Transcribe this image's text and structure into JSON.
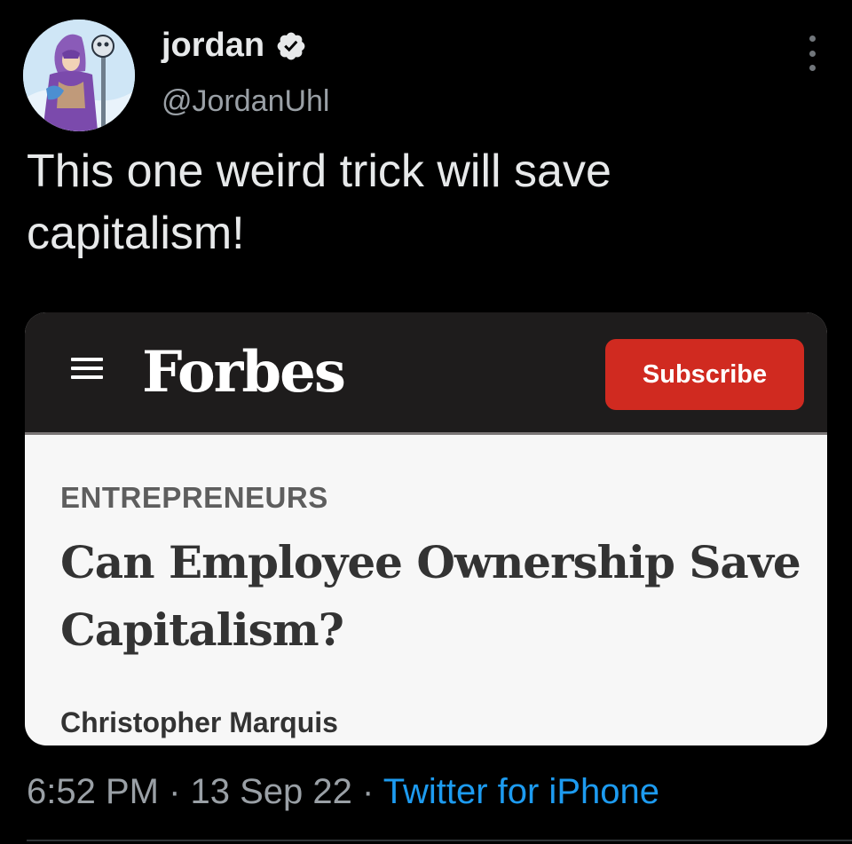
{
  "tweet": {
    "display_name": "jordan",
    "handle": "@JordanUhl",
    "text_line1": "This one weird trick will save",
    "text_line2": "capitalism!",
    "verified": true,
    "avatar_icon": "cartoon-wizard-avatar",
    "more_icon": "vertical-ellipsis-icon"
  },
  "card": {
    "brand": "Forbes",
    "subscribe_label": "Subscribe",
    "section": "ENTREPRENEURS",
    "headline_line1": "Can Employee Ownership Save",
    "headline_line2": "Capitalism?",
    "author": "Christopher Marquis",
    "menu_icon": "hamburger-menu-icon"
  },
  "meta": {
    "time": "6:52 PM",
    "sep1": " · ",
    "date": "13 Sep 22",
    "sep2": " · ",
    "source": "Twitter for iPhone"
  },
  "colors": {
    "background": "#000000",
    "text_primary": "#e7e9ea",
    "text_secondary": "#9aa0a6",
    "link_blue": "#1d9bf0",
    "forbes_header": "#1e1c1c",
    "subscribe_red": "#d02a20"
  }
}
